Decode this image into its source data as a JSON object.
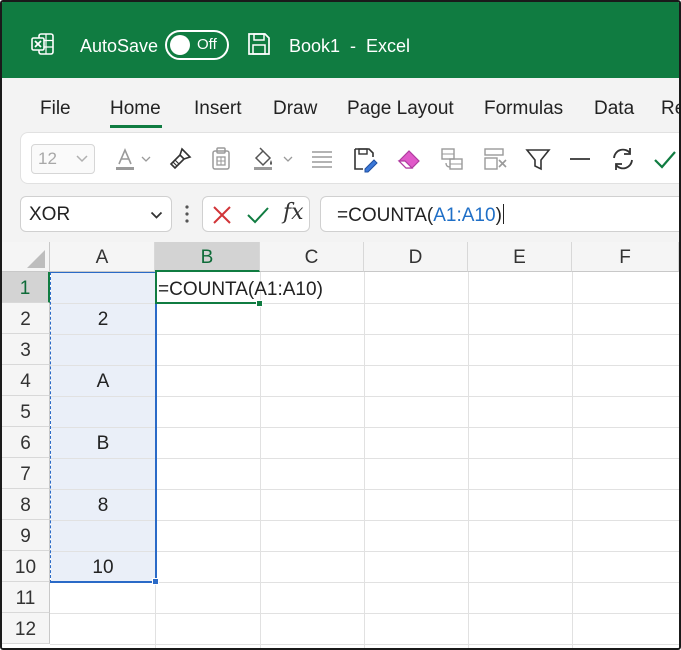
{
  "colors": {
    "excel_green": "#107c41",
    "reference_blue": "#1f6fc7",
    "range_fill": "#eaeff8"
  },
  "title_bar": {
    "app_icon": "excel-logo-icon",
    "autosave_label": "AutoSave",
    "autosave_state": "Off",
    "save_icon": "save-icon",
    "document_title": "Book1  -  Excel"
  },
  "menu": {
    "items": [
      "File",
      "Home",
      "Insert",
      "Draw",
      "Page Layout",
      "Formulas",
      "Data",
      "Re"
    ],
    "active": "Home"
  },
  "ribbon": {
    "font_size": "12",
    "icons": [
      "font-color-icon",
      "format-painter-icon",
      "paste-values-icon",
      "fill-color-icon",
      "align-icon",
      "format-cells-icon",
      "clear-icon",
      "copy-format-icon",
      "delete-cells-icon",
      "filter-icon",
      "line-icon",
      "refresh-icon",
      "check-icon"
    ]
  },
  "formula_bar": {
    "name_box": "XOR",
    "fx_label": "fx",
    "formula_prefix": "=COUNTA(",
    "formula_reference": "A1:A10",
    "formula_suffix": ")"
  },
  "grid": {
    "columns": [
      "A",
      "B",
      "C",
      "D",
      "E",
      "F"
    ],
    "active_column": "B",
    "rows": [
      "1",
      "2",
      "3",
      "4",
      "5",
      "6",
      "7",
      "8",
      "9",
      "10",
      "11",
      "12"
    ],
    "active_row": "1",
    "column_a_values": [
      "",
      "2",
      "",
      "A",
      "",
      "B",
      "",
      "8",
      "",
      "10",
      "",
      ""
    ],
    "b1_prefix": "=COUNTA(",
    "b1_reference": "A1:A10",
    "b1_suffix": ")"
  }
}
